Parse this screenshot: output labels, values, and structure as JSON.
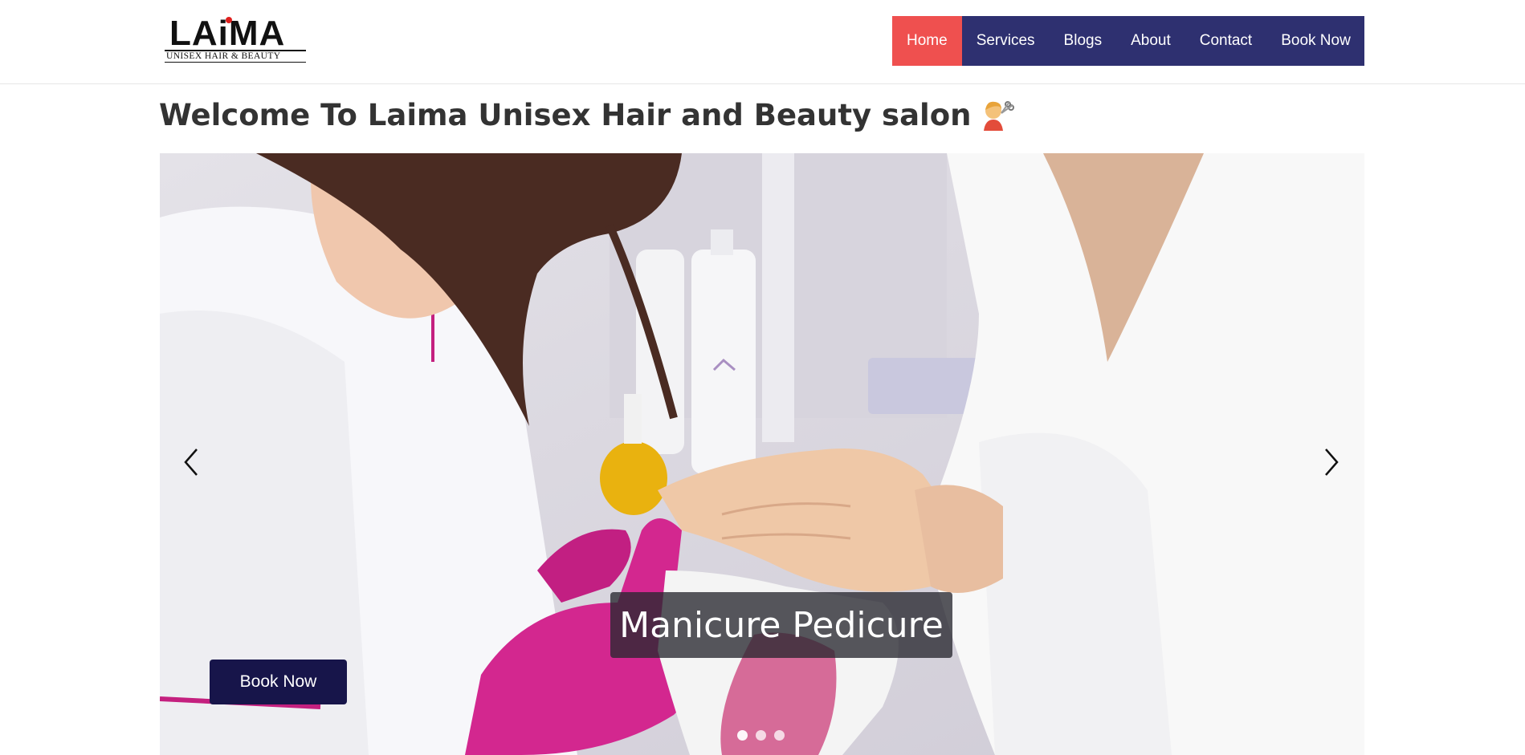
{
  "brand": {
    "logo_text": "LAiMA",
    "logo_subtitle": "UNISEX HAIR & BEAUTY"
  },
  "nav": {
    "items": [
      {
        "label": "Home",
        "active": true
      },
      {
        "label": "Services",
        "active": false
      },
      {
        "label": "Blogs",
        "active": false
      },
      {
        "label": "About",
        "active": false
      },
      {
        "label": "Contact",
        "active": false
      },
      {
        "label": "Book Now",
        "active": false
      }
    ]
  },
  "page": {
    "welcome_title": "Welcome To Laima Unisex Hair and Beauty salon",
    "welcome_icon": "hairdresser-icon"
  },
  "carousel": {
    "caption": "Manicure Pedicure",
    "book_button": "Book Now",
    "prev_icon": "chevron-left-icon",
    "next_icon": "chevron-right-icon",
    "slide_count": 3,
    "active_slide": 1
  },
  "colors": {
    "nav_bg": "#2e3070",
    "nav_active": "#ef504f",
    "book_button": "#17154a",
    "glove_magenta": "#d3278f"
  }
}
